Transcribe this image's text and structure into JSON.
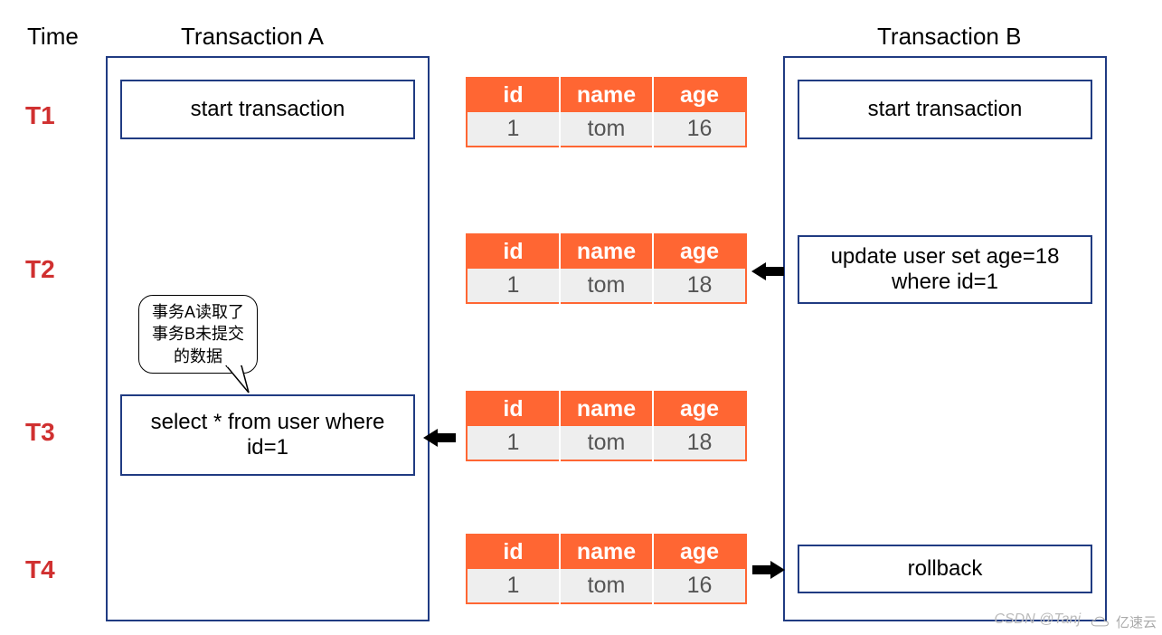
{
  "headers": {
    "time": "Time",
    "txn_a": "Transaction A",
    "txn_b": "Transaction B"
  },
  "time_labels": {
    "t1": "T1",
    "t2": "T2",
    "t3": "T3",
    "t4": "T4"
  },
  "txn_a": {
    "t1": "start transaction",
    "t3": "select * from user where id=1"
  },
  "txn_b": {
    "t1": "start transaction",
    "t2": "update user set age=18 where id=1",
    "t4": "rollback"
  },
  "table": {
    "cols": {
      "id": "id",
      "name": "name",
      "age": "age"
    },
    "rows": {
      "t1": {
        "id": "1",
        "name": "tom",
        "age": "16"
      },
      "t2": {
        "id": "1",
        "name": "tom",
        "age": "18"
      },
      "t3": {
        "id": "1",
        "name": "tom",
        "age": "18"
      },
      "t4": {
        "id": "1",
        "name": "tom",
        "age": "16"
      }
    }
  },
  "bubble": {
    "line1": "事务A读取了",
    "line2": "事务B未提交",
    "line3": "的数据"
  },
  "watermark": {
    "csdn": "CSDN @Tanj",
    "yisu": "亿速云"
  }
}
